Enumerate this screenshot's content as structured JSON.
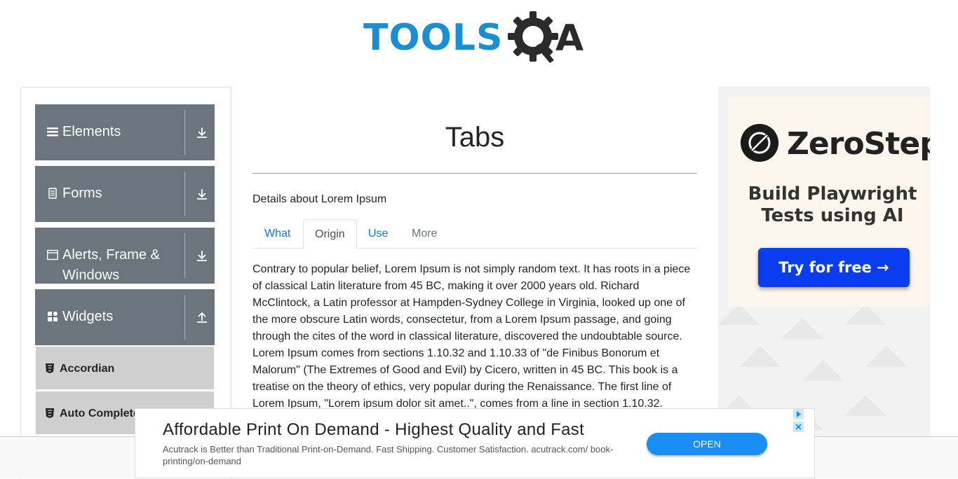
{
  "header": {
    "logo_text": "TOOLS",
    "logo_qa": "A"
  },
  "sidebar": {
    "groups": [
      {
        "label": "Elements",
        "icon": "hamburger-icon"
      },
      {
        "label": "Forms",
        "icon": "document-icon"
      },
      {
        "label": "Alerts, Frame & Windows",
        "icon": "window-icon"
      },
      {
        "label": "Widgets",
        "icon": "grid-icon"
      }
    ],
    "items": [
      {
        "label": "Accordian",
        "icon": "html5-icon"
      },
      {
        "label": "Auto Complete",
        "icon": "html5-icon"
      }
    ]
  },
  "main": {
    "title": "Tabs",
    "details": "Details about Lorem Ipsum",
    "tabs": [
      {
        "label": "What",
        "state": "normal"
      },
      {
        "label": "Origin",
        "state": "active"
      },
      {
        "label": "Use",
        "state": "normal"
      },
      {
        "label": "More",
        "state": "disabled"
      }
    ],
    "content": "Contrary to popular belief, Lorem Ipsum is not simply random text. It has roots in a piece of classical Latin literature from 45 BC, making it over 2000 years old. Richard McClintock, a Latin professor at Hampden-Sydney College in Virginia, looked up one of the more obscure Latin words, consectetur, from a Lorem Ipsum passage, and going through the cites of the word in classical literature, discovered the undoubtable source. Lorem Ipsum comes from sections 1.10.32 and 1.10.33 of \"de Finibus Bonorum et Malorum\" (The Extremes of Good and Evil) by Cicero, written in 45 BC. This book is a treatise on the theory of ethics, very popular during the Renaissance. The first line of Lorem Ipsum, \"Lorem ipsum dolor sit amet..\", comes from a line in section 1.10.32."
  },
  "ad_right": {
    "brand": "ZeroStep",
    "tagline": "Build Playwright Tests using AI",
    "button": "Try for free →"
  },
  "ad_bottom": {
    "title": "Affordable Print On Demand - Highest Quality and Fast",
    "description": "Acutrack is Better than Traditional Print-on-Demand. Fast Shipping. Customer Satisfaction. acutrack.com/ book-printing/on-demand",
    "button": "OPEN"
  },
  "colors": {
    "accent": "#007bff",
    "sidebar_group": "#6c757d",
    "logo_blue": "#1a8ed4",
    "zs_button": "#0a3cf0"
  }
}
